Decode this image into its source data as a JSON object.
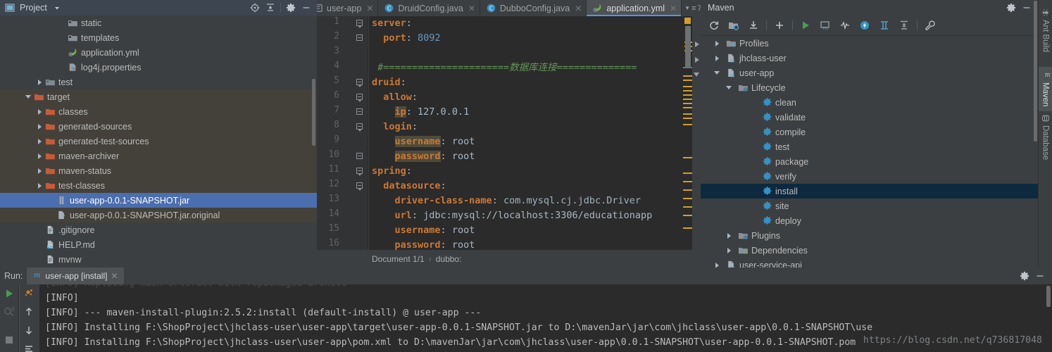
{
  "project_panel": {
    "title": "Project",
    "header_icons": [
      "project-dropdown-icon",
      "locate-icon",
      "collapse-all-icon",
      "gear-icon",
      "minimize-icon"
    ],
    "tree": [
      {
        "label": "static",
        "icon": "folder-web-icon",
        "indent": 5,
        "twist": "none",
        "state": "normal"
      },
      {
        "label": "templates",
        "icon": "folder-web-icon",
        "indent": 5,
        "twist": "none",
        "state": "normal"
      },
      {
        "label": "application.yml",
        "icon": "spring-yml-icon",
        "indent": 5,
        "twist": "none",
        "state": "normal"
      },
      {
        "label": "log4j.properties",
        "icon": "properties-icon",
        "indent": 5,
        "twist": "none",
        "state": "normal"
      },
      {
        "label": "test",
        "icon": "folder-test-icon",
        "indent": 3,
        "twist": "closed",
        "state": "normal"
      },
      {
        "label": "target",
        "icon": "folder-excluded-icon",
        "indent": 2,
        "twist": "open",
        "state": "target"
      },
      {
        "label": "classes",
        "icon": "folder-excluded-icon",
        "indent": 3,
        "twist": "closed",
        "state": "target"
      },
      {
        "label": "generated-sources",
        "icon": "folder-excluded-icon",
        "indent": 3,
        "twist": "closed",
        "state": "target"
      },
      {
        "label": "generated-test-sources",
        "icon": "folder-excluded-icon",
        "indent": 3,
        "twist": "closed",
        "state": "target"
      },
      {
        "label": "maven-archiver",
        "icon": "folder-excluded-icon",
        "indent": 3,
        "twist": "closed",
        "state": "target"
      },
      {
        "label": "maven-status",
        "icon": "folder-excluded-icon",
        "indent": 3,
        "twist": "closed",
        "state": "target"
      },
      {
        "label": "test-classes",
        "icon": "folder-excluded-icon",
        "indent": 3,
        "twist": "closed",
        "state": "target"
      },
      {
        "label": "user-app-0.0.1-SNAPSHOT.jar",
        "icon": "jar-icon",
        "indent": 4,
        "twist": "none",
        "state": "selected"
      },
      {
        "label": "user-app-0.0.1-SNAPSHOT.jar.original",
        "icon": "unknown-file-icon",
        "indent": 4,
        "twist": "none",
        "state": "target"
      },
      {
        "label": ".gitignore",
        "icon": "text-file-icon",
        "indent": 3,
        "twist": "none",
        "state": "normal"
      },
      {
        "label": "HELP.md",
        "icon": "markdown-icon",
        "indent": 3,
        "twist": "none",
        "state": "normal"
      },
      {
        "label": "mvnw",
        "icon": "text-file-icon",
        "indent": 3,
        "twist": "none",
        "state": "normal"
      }
    ]
  },
  "editor": {
    "tabs": [
      {
        "label": "user-app",
        "icon": "module-icon",
        "active": false,
        "closable": true
      },
      {
        "label": "DruidConfig.java",
        "icon": "java-class-icon",
        "active": false,
        "closable": true
      },
      {
        "label": "DubboConfig.java",
        "icon": "java-class-icon",
        "active": false,
        "closable": true
      },
      {
        "label": "application.yml",
        "icon": "spring-yml-icon",
        "active": true,
        "closable": true
      }
    ],
    "tab_overflow_count": "7",
    "lines": [
      {
        "n": "1",
        "fold": "head",
        "segments": [
          {
            "t": "server",
            "c": "key"
          },
          {
            "t": ":",
            "c": "plain"
          }
        ]
      },
      {
        "n": "2",
        "fold": "end",
        "segments": [
          {
            "t": "  ",
            "c": "plain"
          },
          {
            "t": "port",
            "c": "key"
          },
          {
            "t": ": ",
            "c": "plain"
          },
          {
            "t": "8092",
            "c": "num"
          }
        ]
      },
      {
        "n": "3",
        "fold": "none",
        "segments": []
      },
      {
        "n": "4",
        "fold": "none",
        "segments": [
          {
            "t": " #======================数据库连接==============",
            "c": "comment"
          }
        ]
      },
      {
        "n": "5",
        "fold": "head",
        "segments": [
          {
            "t": "druid",
            "c": "key"
          },
          {
            "t": ":",
            "c": "plain"
          }
        ]
      },
      {
        "n": "6",
        "fold": "head",
        "segments": [
          {
            "t": "  ",
            "c": "plain"
          },
          {
            "t": "allow",
            "c": "key"
          },
          {
            "t": ":",
            "c": "plain"
          }
        ]
      },
      {
        "n": "7",
        "fold": "end",
        "segments": [
          {
            "t": "    ",
            "c": "plain"
          },
          {
            "t": "ip",
            "c": "key-hl"
          },
          {
            "t": ": ",
            "c": "plain"
          },
          {
            "t": "127.0.0.1",
            "c": "plain"
          }
        ]
      },
      {
        "n": "8",
        "fold": "head",
        "segments": [
          {
            "t": "  ",
            "c": "plain"
          },
          {
            "t": "login",
            "c": "key"
          },
          {
            "t": ":",
            "c": "plain"
          }
        ]
      },
      {
        "n": "9",
        "fold": "none",
        "segments": [
          {
            "t": "    ",
            "c": "plain"
          },
          {
            "t": "username",
            "c": "key-hl"
          },
          {
            "t": ": ",
            "c": "plain"
          },
          {
            "t": "root",
            "c": "plain"
          }
        ]
      },
      {
        "n": "10",
        "fold": "end",
        "segments": [
          {
            "t": "    ",
            "c": "plain"
          },
          {
            "t": "password",
            "c": "key-hl"
          },
          {
            "t": ": ",
            "c": "plain"
          },
          {
            "t": "root",
            "c": "plain"
          }
        ]
      },
      {
        "n": "11",
        "fold": "head",
        "segments": [
          {
            "t": "spring",
            "c": "key"
          },
          {
            "t": ":",
            "c": "plain"
          }
        ]
      },
      {
        "n": "12",
        "fold": "head",
        "segments": [
          {
            "t": "  ",
            "c": "plain"
          },
          {
            "t": "datasource",
            "c": "key"
          },
          {
            "t": ":",
            "c": "plain"
          }
        ]
      },
      {
        "n": "13",
        "fold": "none",
        "segments": [
          {
            "t": "    ",
            "c": "plain"
          },
          {
            "t": "driver-class-name",
            "c": "key"
          },
          {
            "t": ": ",
            "c": "plain"
          },
          {
            "t": "com.mysql.cj.jdbc.Driver",
            "c": "ident"
          }
        ]
      },
      {
        "n": "14",
        "fold": "none",
        "segments": [
          {
            "t": "    ",
            "c": "plain"
          },
          {
            "t": "url",
            "c": "key"
          },
          {
            "t": ": ",
            "c": "plain"
          },
          {
            "t": "jdbc:mysql://localhost:3306/educationapp",
            "c": "plain"
          }
        ]
      },
      {
        "n": "15",
        "fold": "none",
        "segments": [
          {
            "t": "    ",
            "c": "plain"
          },
          {
            "t": "username",
            "c": "key"
          },
          {
            "t": ": ",
            "c": "plain"
          },
          {
            "t": "root",
            "c": "plain"
          }
        ]
      },
      {
        "n": "16",
        "fold": "none",
        "segments": [
          {
            "t": "    ",
            "c": "plain"
          },
          {
            "t": "password",
            "c": "key"
          },
          {
            "t": ": ",
            "c": "plain"
          },
          {
            "t": "root",
            "c": "plain"
          }
        ]
      }
    ],
    "breadcrumb": {
      "document": "Document 1/1",
      "separator": "›",
      "node": "dubbo:"
    }
  },
  "maven": {
    "title": "Maven",
    "header_icons": [
      "gear-icon",
      "minimize-icon"
    ],
    "toolbar_icons": [
      "reimport-icon",
      "generate-sources-icon",
      "download-sources-icon",
      "add-icon",
      "run-icon",
      "run-maven-build-icon",
      "skip-tests-icon",
      "execute-goal-icon",
      "toggle-offline-icon",
      "collapse-all-icon",
      "maven-settings-icon"
    ],
    "tree": [
      {
        "label": "Profiles",
        "icon": "profiles-icon",
        "indent": 1,
        "twist": "closed",
        "selected": false
      },
      {
        "label": "jhclass-user",
        "icon": "maven-project-icon",
        "indent": 1,
        "twist": "closed",
        "selected": false
      },
      {
        "label": "user-app",
        "icon": "maven-project-icon",
        "indent": 1,
        "twist": "open",
        "selected": false
      },
      {
        "label": "Lifecycle",
        "icon": "lifecycle-folder-icon",
        "indent": 2,
        "twist": "open",
        "selected": false
      },
      {
        "label": "clean",
        "icon": "maven-goal-icon",
        "indent": 4,
        "twist": "none",
        "selected": false
      },
      {
        "label": "validate",
        "icon": "maven-goal-icon",
        "indent": 4,
        "twist": "none",
        "selected": false
      },
      {
        "label": "compile",
        "icon": "maven-goal-icon",
        "indent": 4,
        "twist": "none",
        "selected": false
      },
      {
        "label": "test",
        "icon": "maven-goal-icon",
        "indent": 4,
        "twist": "none",
        "selected": false
      },
      {
        "label": "package",
        "icon": "maven-goal-icon",
        "indent": 4,
        "twist": "none",
        "selected": false
      },
      {
        "label": "verify",
        "icon": "maven-goal-icon",
        "indent": 4,
        "twist": "none",
        "selected": false
      },
      {
        "label": "install",
        "icon": "maven-goal-icon",
        "indent": 4,
        "twist": "none",
        "selected": true
      },
      {
        "label": "site",
        "icon": "maven-goal-icon",
        "indent": 4,
        "twist": "none",
        "selected": false
      },
      {
        "label": "deploy",
        "icon": "maven-goal-icon",
        "indent": 4,
        "twist": "none",
        "selected": false
      },
      {
        "label": "Plugins",
        "icon": "plugins-folder-icon",
        "indent": 2,
        "twist": "closed",
        "selected": false
      },
      {
        "label": "Dependencies",
        "icon": "dependencies-icon",
        "indent": 2,
        "twist": "closed",
        "selected": false
      },
      {
        "label": "user-service-api",
        "icon": "maven-project-icon",
        "indent": 1,
        "twist": "closed",
        "selected": false
      }
    ]
  },
  "right_strip": {
    "tabs": [
      {
        "label": "Ant Build",
        "icon": "ant-icon",
        "active": false
      },
      {
        "label": "Maven",
        "icon": "maven-icon",
        "active": true
      },
      {
        "label": "Database",
        "icon": "database-icon",
        "active": false
      }
    ]
  },
  "run_panel": {
    "label": "Run:",
    "tab": {
      "label": "user-app [install]",
      "icon": "maven-m-icon"
    },
    "header_icons": [
      "gear-icon",
      "minimize-icon"
    ],
    "side_buttons_a": [
      "rerun-icon",
      "debug-9-icon",
      "stop-icon"
    ],
    "side_buttons_b": [
      "toggle-soft-wrap-icon",
      "scroll-up-icon",
      "scroll-down-icon",
      "print-icon"
    ],
    "console_lines": [
      {
        "text": "[INFO] Replacing main artifact with repackaged archive",
        "faded": true
      },
      {
        "text": "[INFO]",
        "faded": false
      },
      {
        "text": "[INFO] --- maven-install-plugin:2.5.2:install (default-install) @ user-app ---",
        "faded": false
      },
      {
        "text": "[INFO] Installing F:\\ShopProject\\jhclass-user\\user-app\\target\\user-app-0.0.1-SNAPSHOT.jar to D:\\mavenJar\\jar\\com\\jhclass\\user-app\\0.0.1-SNAPSHOT\\use",
        "faded": false
      },
      {
        "text": "[INFO] Installing F:\\ShopProject\\jhclass-user\\user-app\\pom.xml to D:\\mavenJar\\jar\\com\\jhclass\\user-app\\0.0.1-SNAPSHOT\\user-app-0.0.1-SNAPSHOT.pom",
        "faded": false
      }
    ],
    "overlap_text": "https://blog.csdn.net/q736817048"
  },
  "colors": {
    "background": "#3c3f41",
    "editor_bg": "#2b2b2b",
    "selection_blue": "#4b6eaf",
    "maven_selection": "#0d293e",
    "accent_orange": "#cc7832",
    "accent_green": "#629755",
    "accent_number": "#6897bb",
    "panel_header": "#3c4550",
    "folder_excluded": "#c75b39"
  }
}
